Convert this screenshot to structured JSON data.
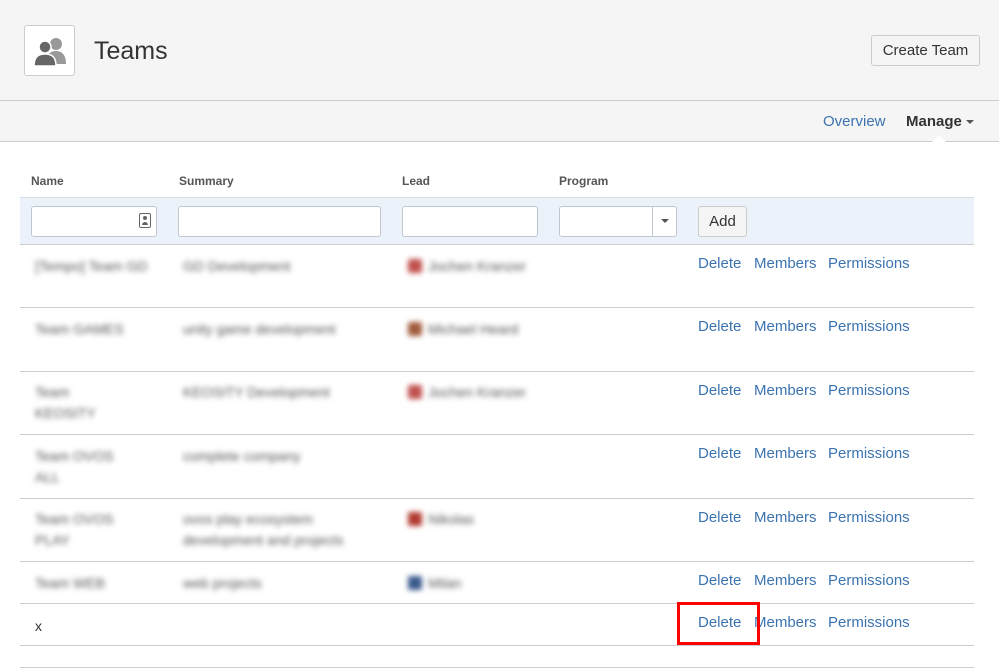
{
  "header": {
    "title": "Teams",
    "create_button": "Create Team"
  },
  "nav": {
    "overview": "Overview",
    "manage": "Manage"
  },
  "table": {
    "columns": [
      "Name",
      "Summary",
      "Lead",
      "Program"
    ],
    "add_button": "Add",
    "actions": [
      "Delete",
      "Members",
      "Permissions"
    ],
    "rows": [
      {
        "name": "[Tempo] Team GD",
        "summary": "GD Development",
        "lead": "Jochen Kranzer",
        "avatar_color": "#c0504d"
      },
      {
        "name": "Team GAMES",
        "summary": "unity game development",
        "lead": "Michael Heard",
        "avatar_color": "#a05a3c"
      },
      {
        "name": "Team KEOSITY",
        "summary": "KEOSITY Development",
        "lead": "Jochen Kranzer",
        "avatar_color": "#c0504d"
      },
      {
        "name": "Team OVOS ALL",
        "summary": "complete company",
        "lead": "",
        "avatar_color": ""
      },
      {
        "name": "Team OVOS PLAY",
        "summary": "ovos play ecosystem development and projects",
        "lead": "Nikolas",
        "avatar_color": "#b03a2e"
      },
      {
        "name": "Team WEB",
        "summary": "web projects",
        "lead": "Milan",
        "avatar_color": "#3a5a8c"
      },
      {
        "name": "x",
        "summary": "",
        "lead": "",
        "avatar_color": ""
      }
    ]
  },
  "colors": {
    "link": "#3b73af",
    "highlight": "#ff0000",
    "filter_bg": "#ebf2f9"
  }
}
